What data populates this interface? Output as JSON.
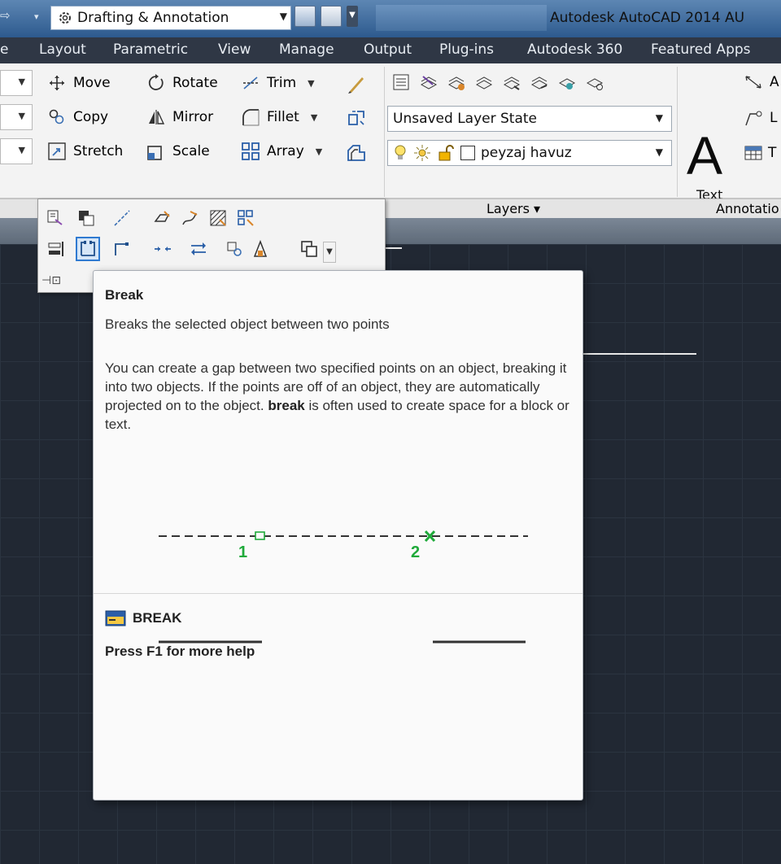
{
  "titlebar": {
    "workspace": "Drafting & Annotation",
    "app_title": "Autodesk AutoCAD 2014   AU"
  },
  "menu": {
    "tabs": [
      "e",
      "Layout",
      "Parametric",
      "View",
      "Manage",
      "Output",
      "Plug-ins",
      "Autodesk 360",
      "Featured Apps"
    ]
  },
  "modify": {
    "move": "Move",
    "rotate": "Rotate",
    "trim": "Trim",
    "copy": "Copy",
    "mirror": "Mirror",
    "fillet": "Fillet",
    "stretch": "Stretch",
    "scale": "Scale",
    "array": "Array"
  },
  "layers": {
    "state": "Unsaved Layer State",
    "current_layer": "peyzaj havuz",
    "panel_label": "Layers"
  },
  "annotation": {
    "text_label": "Text",
    "panel_label": "Annotatio",
    "items": [
      "A",
      "L",
      "T"
    ]
  },
  "tooltip": {
    "title": "Break",
    "short_desc": "Breaks the selected object between two points",
    "body_before": "You can create a gap between two specified points on an object, breaking it into two objects. If the points are off of an object, they are automatically projected on to the object. ",
    "body_bold": "break",
    "body_after": " is often used to create space for a block or text.",
    "point1": "1",
    "point2": "2",
    "command": "BREAK",
    "help": "Press F1 for more help"
  }
}
